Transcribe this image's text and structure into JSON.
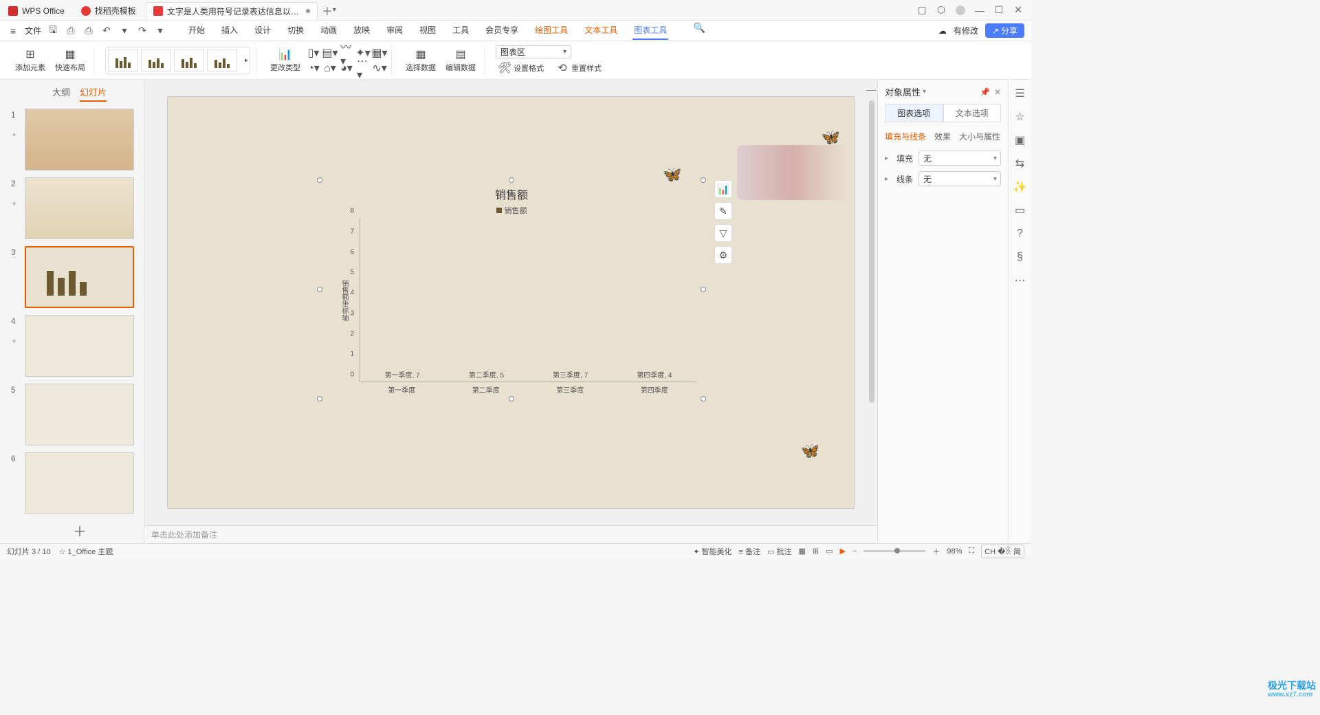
{
  "tabs": {
    "wps": "WPS Office",
    "templates": "找稻壳模板",
    "doc": "文字是人类用符号记录表达信息以…"
  },
  "menubar": {
    "file": "文件",
    "tabs": [
      "开始",
      "插入",
      "设计",
      "切换",
      "动画",
      "放映",
      "审阅",
      "视图",
      "工具",
      "会员专享"
    ],
    "context_tabs": [
      "绘图工具",
      "文本工具",
      "图表工具"
    ],
    "pending": "有修改",
    "share": "分享"
  },
  "ribbon": {
    "add_element": "添加元素",
    "quick_layout": "快速布局",
    "change_type": "更改类型",
    "select_data": "选择数据",
    "edit_data": "编辑数据",
    "set_format": "设置格式",
    "reset_style": "重置样式",
    "chart_area_select": "图表区"
  },
  "outline_tabs": {
    "outline": "大纲",
    "slides": "幻灯片"
  },
  "right_pane": {
    "title": "对象属性",
    "sub1": "图表选项",
    "sub2": "文本选项",
    "t1": "填充与线条",
    "t2": "效果",
    "t3": "大小与属性",
    "fill_label": "填充",
    "line_label": "线条",
    "none": "无"
  },
  "notes_placeholder": "单击此处添加备注",
  "status": {
    "slide_counter": "幻灯片 3 / 10",
    "theme": "1_Office 主题",
    "beautify": "智能美化",
    "notes": "备注",
    "comments": "批注",
    "zoom": "98%",
    "ime": "CH �ꆬ 简"
  },
  "watermark": {
    "brand": "极光下载站",
    "url": "www.xz7.com"
  },
  "chart_data": {
    "type": "bar",
    "title": "销售额",
    "legend": "销售额",
    "ylabel": "销售额坐标轴",
    "ylim": [
      0,
      8
    ],
    "ticks": [
      0,
      1,
      2,
      3,
      4,
      5,
      6,
      7,
      8
    ],
    "categories": [
      "第一季度",
      "第二季度",
      "第三季度",
      "第四季度"
    ],
    "values": [
      7,
      5,
      7,
      4
    ],
    "data_labels": [
      "第一季度, 7",
      "第二季度, 5",
      "第三季度, 7",
      "第四季度, 4"
    ]
  }
}
